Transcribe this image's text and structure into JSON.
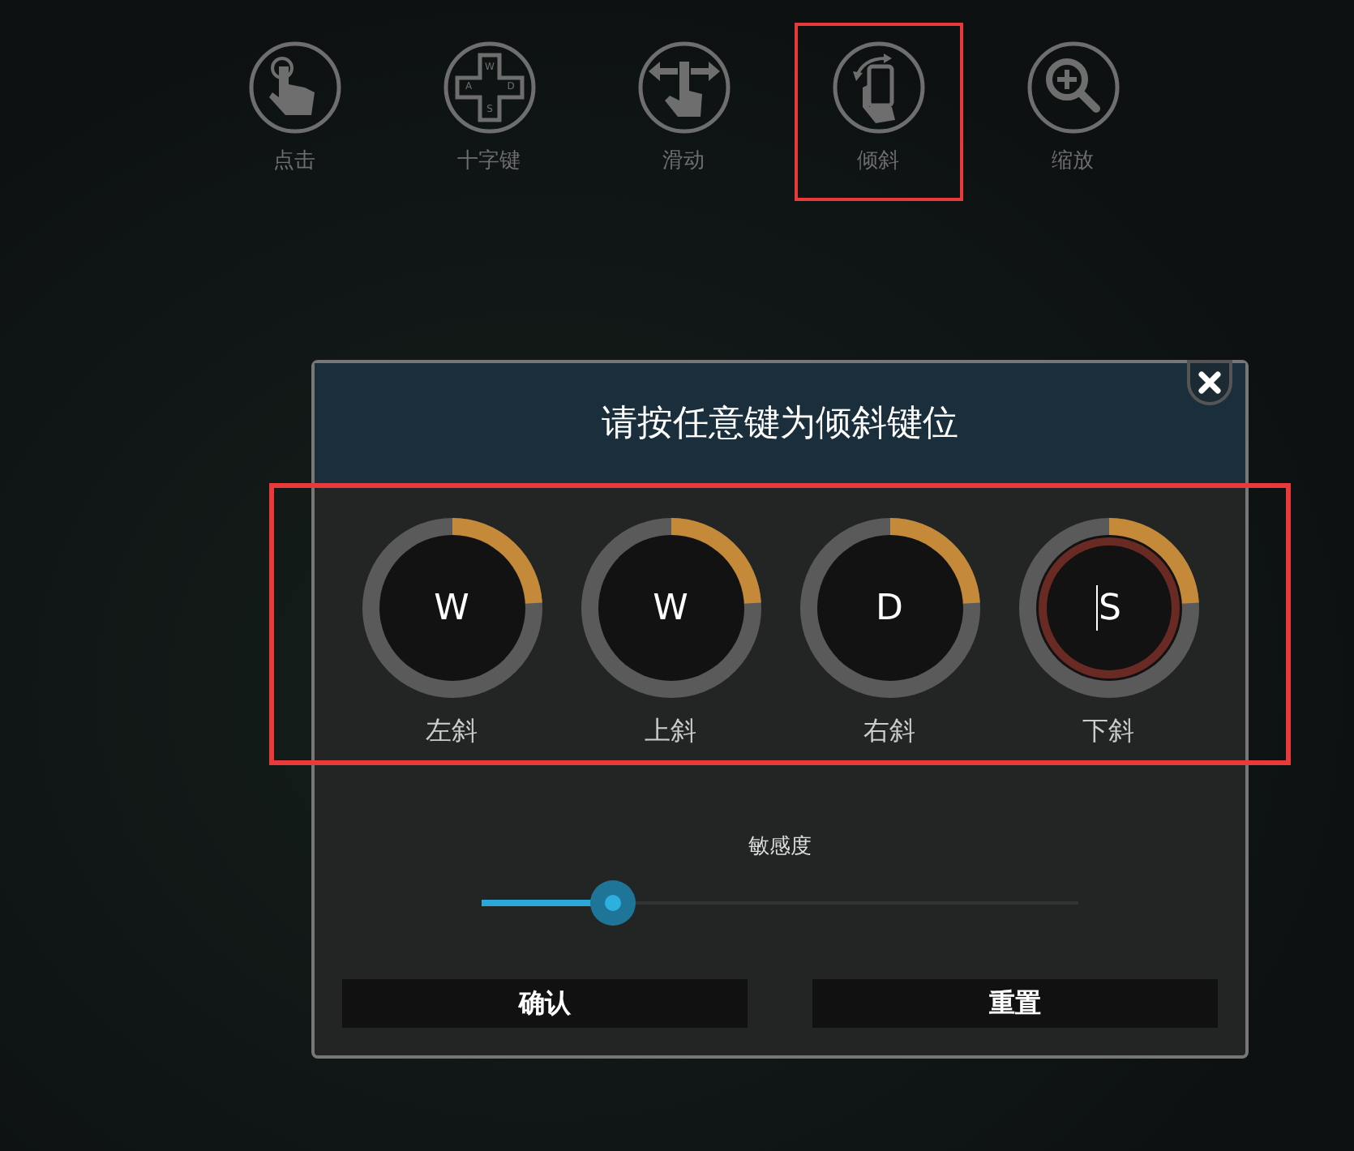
{
  "modes": [
    {
      "kind": "tap",
      "label": "点击",
      "selected": false
    },
    {
      "kind": "dpad",
      "label": "十字键",
      "selected": false,
      "keys": [
        "W",
        "A",
        "D",
        "S"
      ]
    },
    {
      "kind": "swipe",
      "label": "滑动",
      "selected": false
    },
    {
      "kind": "tilt",
      "label": "倾斜",
      "selected": true
    },
    {
      "kind": "zoom",
      "label": "缩放",
      "selected": false
    }
  ],
  "dialog": {
    "title": "请按任意键为倾斜键位",
    "keys_highlighted": true,
    "keys": [
      {
        "key": "W",
        "label": "左斜",
        "level": 0.24,
        "editing": false
      },
      {
        "key": "W",
        "label": "上斜",
        "level": 0.24,
        "editing": false
      },
      {
        "key": "D",
        "label": "右斜",
        "level": 0.24,
        "editing": false
      },
      {
        "key": "S",
        "label": "下斜",
        "level": 0.24,
        "editing": true
      }
    ],
    "sensitivity": {
      "label": "敏感度",
      "level": 0.22
    },
    "buttons": [
      "确认",
      "重置"
    ]
  }
}
